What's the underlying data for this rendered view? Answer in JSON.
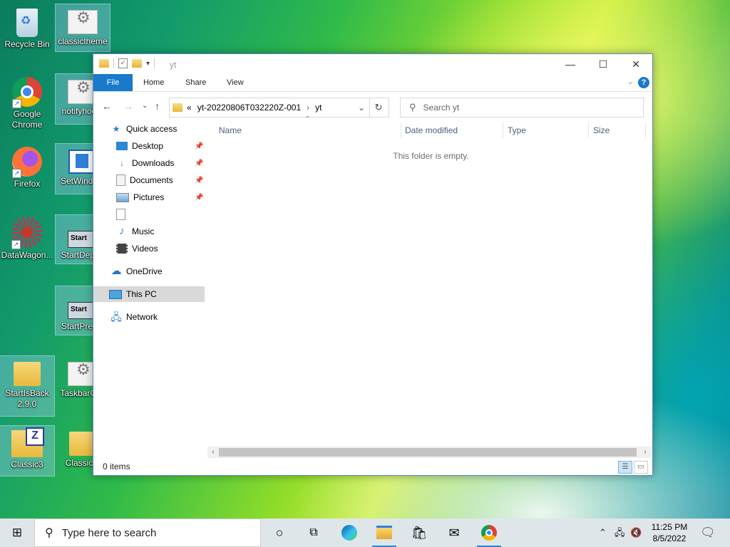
{
  "desktop": {
    "icons": [
      {
        "label": "Recycle Bin"
      },
      {
        "label": "classictheme"
      },
      {
        "label": "Google Chrome"
      },
      {
        "label": "notifyhoo..."
      },
      {
        "label": "Firefox"
      },
      {
        "label": "SetWindo..."
      },
      {
        "label": "DataWagon..."
      },
      {
        "label": "StartDepr..."
      },
      {
        "label": "StartPres..."
      },
      {
        "label": "StartIsBack 2.9.0"
      },
      {
        "label": "TaskbarCl..."
      },
      {
        "label": "Classic3"
      },
      {
        "label": "Classic..."
      }
    ]
  },
  "window": {
    "title": "yt",
    "ribbon": {
      "tabs": [
        "File",
        "Home",
        "Share",
        "View"
      ],
      "help": "?"
    },
    "address": {
      "overflow": "«",
      "segments": [
        "yt-20220806T032220Z-001",
        "yt"
      ]
    },
    "search_placeholder": "Search yt",
    "nav": {
      "quick_access": "Quick access",
      "items": [
        "Desktop",
        "Downloads",
        "Documents",
        "Pictures",
        "",
        "Music",
        "Videos"
      ],
      "onedrive": "OneDrive",
      "this_pc": "This PC",
      "network": "Network"
    },
    "columns": [
      "Name",
      "Date modified",
      "Type",
      "Size"
    ],
    "empty_message": "This folder is empty.",
    "status": "0 items"
  },
  "taskbar": {
    "search_placeholder": "Type here to search",
    "time": "11:25 PM",
    "date": "8/5/2022"
  },
  "colors": {
    "accent": "#1979ca",
    "selection": "#d9d9d9"
  }
}
